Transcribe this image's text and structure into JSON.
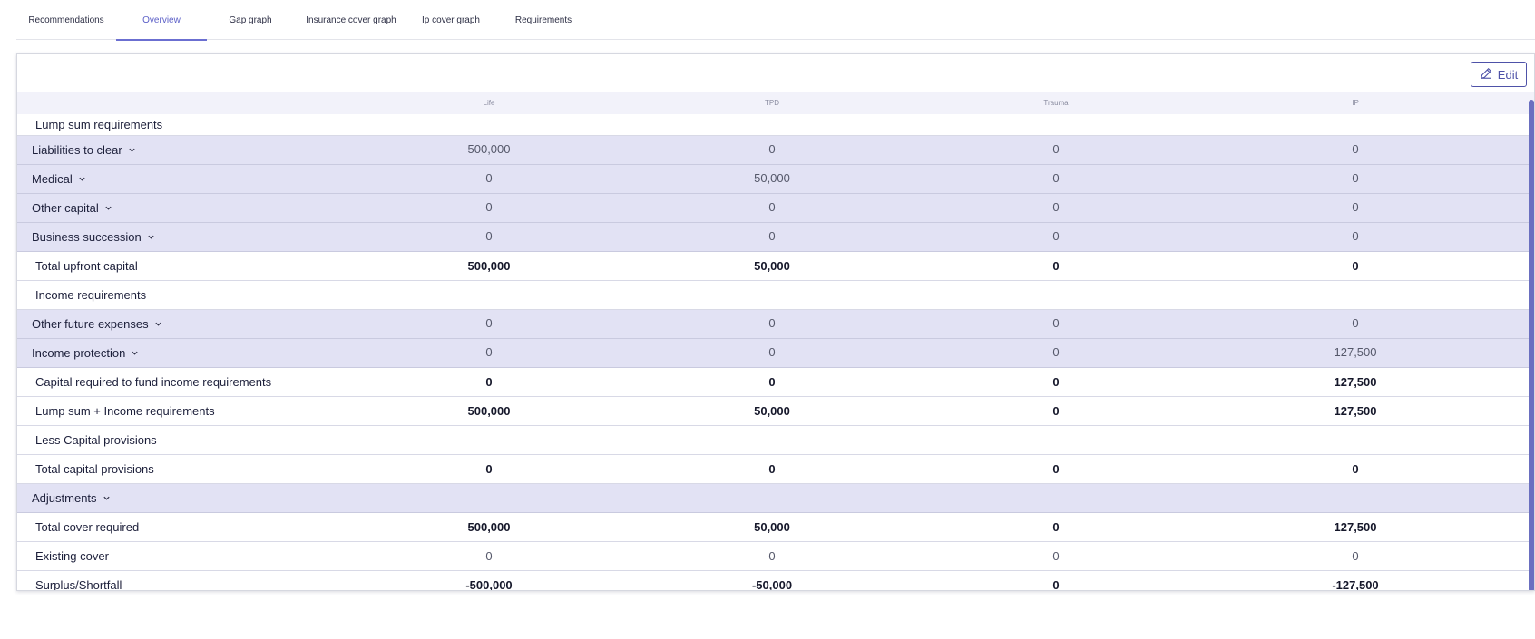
{
  "tabs": [
    {
      "label": "Recommendations",
      "active": false
    },
    {
      "label": "Overview",
      "active": true
    },
    {
      "label": "Gap graph",
      "active": false
    },
    {
      "label": "Insurance cover graph",
      "active": false
    },
    {
      "label": "Ip cover graph",
      "active": false
    },
    {
      "label": "Requirements",
      "active": false
    }
  ],
  "edit_label": "Edit",
  "columns": [
    "Life",
    "TPD",
    "Trauma",
    "IP"
  ],
  "rows": [
    {
      "label": "Lump sum requirements",
      "type": "section",
      "values": []
    },
    {
      "label": "Liabilities to clear",
      "type": "sub",
      "values": [
        "500,000",
        "0",
        "0",
        "0"
      ]
    },
    {
      "label": "Medical",
      "type": "sub",
      "values": [
        "0",
        "50,000",
        "0",
        "0"
      ]
    },
    {
      "label": "Other capital",
      "type": "sub",
      "values": [
        "0",
        "0",
        "0",
        "0"
      ]
    },
    {
      "label": "Business succession",
      "type": "sub",
      "values": [
        "0",
        "0",
        "0",
        "0"
      ]
    },
    {
      "label": "Total upfront capital",
      "type": "total",
      "values": [
        "500,000",
        "50,000",
        "0",
        "0"
      ]
    },
    {
      "label": "Income requirements",
      "type": "section",
      "values": []
    },
    {
      "label": "Other future expenses",
      "type": "sub",
      "values": [
        "0",
        "0",
        "0",
        "0"
      ]
    },
    {
      "label": "Income protection",
      "type": "sub",
      "values": [
        "0",
        "0",
        "0",
        "127,500"
      ]
    },
    {
      "label": "Capital required to fund income requirements",
      "type": "total",
      "values": [
        "0",
        "0",
        "0",
        "127,500"
      ]
    },
    {
      "label": "Lump sum + Income requirements",
      "type": "total",
      "values": [
        "500,000",
        "50,000",
        "0",
        "127,500"
      ]
    },
    {
      "label": "Less Capital provisions",
      "type": "section",
      "values": []
    },
    {
      "label": "Total capital provisions",
      "type": "total",
      "values": [
        "0",
        "0",
        "0",
        "0"
      ]
    },
    {
      "label": "Adjustments",
      "type": "sub",
      "values": []
    },
    {
      "label": "Total cover required",
      "type": "total",
      "values": [
        "500,000",
        "50,000",
        "0",
        "127,500"
      ]
    },
    {
      "label": "Existing cover",
      "type": "plain",
      "values": [
        "0",
        "0",
        "0",
        "0"
      ]
    },
    {
      "label": "Surplus/Shortfall",
      "type": "total",
      "values": [
        "-500,000",
        "-50,000",
        "0",
        "-127,500"
      ]
    }
  ]
}
